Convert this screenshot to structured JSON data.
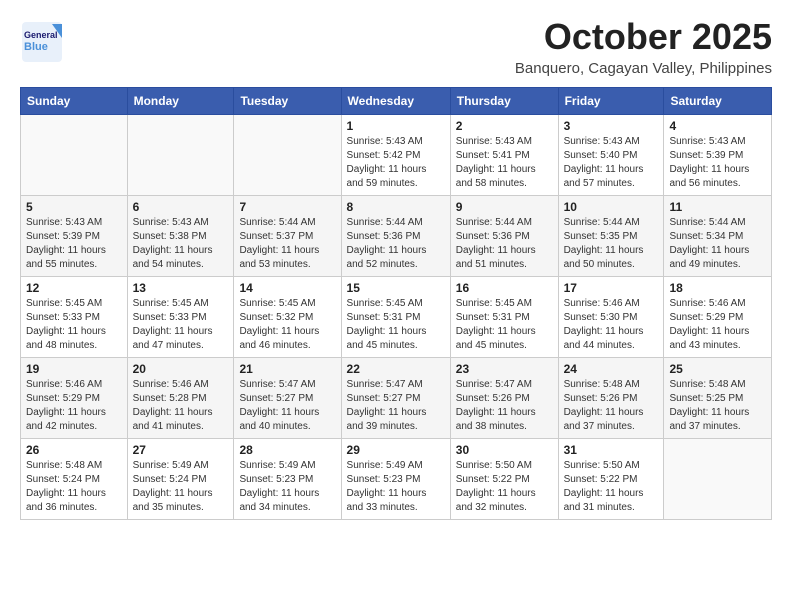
{
  "logo": {
    "line1": "General",
    "line2": "Blue"
  },
  "title": "October 2025",
  "location": "Banquero, Cagayan Valley, Philippines",
  "days_of_week": [
    "Sunday",
    "Monday",
    "Tuesday",
    "Wednesday",
    "Thursday",
    "Friday",
    "Saturday"
  ],
  "weeks": [
    [
      {
        "day": "",
        "info": ""
      },
      {
        "day": "",
        "info": ""
      },
      {
        "day": "",
        "info": ""
      },
      {
        "day": "1",
        "info": "Sunrise: 5:43 AM\nSunset: 5:42 PM\nDaylight: 11 hours\nand 59 minutes."
      },
      {
        "day": "2",
        "info": "Sunrise: 5:43 AM\nSunset: 5:41 PM\nDaylight: 11 hours\nand 58 minutes."
      },
      {
        "day": "3",
        "info": "Sunrise: 5:43 AM\nSunset: 5:40 PM\nDaylight: 11 hours\nand 57 minutes."
      },
      {
        "day": "4",
        "info": "Sunrise: 5:43 AM\nSunset: 5:39 PM\nDaylight: 11 hours\nand 56 minutes."
      }
    ],
    [
      {
        "day": "5",
        "info": "Sunrise: 5:43 AM\nSunset: 5:39 PM\nDaylight: 11 hours\nand 55 minutes."
      },
      {
        "day": "6",
        "info": "Sunrise: 5:43 AM\nSunset: 5:38 PM\nDaylight: 11 hours\nand 54 minutes."
      },
      {
        "day": "7",
        "info": "Sunrise: 5:44 AM\nSunset: 5:37 PM\nDaylight: 11 hours\nand 53 minutes."
      },
      {
        "day": "8",
        "info": "Sunrise: 5:44 AM\nSunset: 5:36 PM\nDaylight: 11 hours\nand 52 minutes."
      },
      {
        "day": "9",
        "info": "Sunrise: 5:44 AM\nSunset: 5:36 PM\nDaylight: 11 hours\nand 51 minutes."
      },
      {
        "day": "10",
        "info": "Sunrise: 5:44 AM\nSunset: 5:35 PM\nDaylight: 11 hours\nand 50 minutes."
      },
      {
        "day": "11",
        "info": "Sunrise: 5:44 AM\nSunset: 5:34 PM\nDaylight: 11 hours\nand 49 minutes."
      }
    ],
    [
      {
        "day": "12",
        "info": "Sunrise: 5:45 AM\nSunset: 5:33 PM\nDaylight: 11 hours\nand 48 minutes."
      },
      {
        "day": "13",
        "info": "Sunrise: 5:45 AM\nSunset: 5:33 PM\nDaylight: 11 hours\nand 47 minutes."
      },
      {
        "day": "14",
        "info": "Sunrise: 5:45 AM\nSunset: 5:32 PM\nDaylight: 11 hours\nand 46 minutes."
      },
      {
        "day": "15",
        "info": "Sunrise: 5:45 AM\nSunset: 5:31 PM\nDaylight: 11 hours\nand 45 minutes."
      },
      {
        "day": "16",
        "info": "Sunrise: 5:45 AM\nSunset: 5:31 PM\nDaylight: 11 hours\nand 45 minutes."
      },
      {
        "day": "17",
        "info": "Sunrise: 5:46 AM\nSunset: 5:30 PM\nDaylight: 11 hours\nand 44 minutes."
      },
      {
        "day": "18",
        "info": "Sunrise: 5:46 AM\nSunset: 5:29 PM\nDaylight: 11 hours\nand 43 minutes."
      }
    ],
    [
      {
        "day": "19",
        "info": "Sunrise: 5:46 AM\nSunset: 5:29 PM\nDaylight: 11 hours\nand 42 minutes."
      },
      {
        "day": "20",
        "info": "Sunrise: 5:46 AM\nSunset: 5:28 PM\nDaylight: 11 hours\nand 41 minutes."
      },
      {
        "day": "21",
        "info": "Sunrise: 5:47 AM\nSunset: 5:27 PM\nDaylight: 11 hours\nand 40 minutes."
      },
      {
        "day": "22",
        "info": "Sunrise: 5:47 AM\nSunset: 5:27 PM\nDaylight: 11 hours\nand 39 minutes."
      },
      {
        "day": "23",
        "info": "Sunrise: 5:47 AM\nSunset: 5:26 PM\nDaylight: 11 hours\nand 38 minutes."
      },
      {
        "day": "24",
        "info": "Sunrise: 5:48 AM\nSunset: 5:26 PM\nDaylight: 11 hours\nand 37 minutes."
      },
      {
        "day": "25",
        "info": "Sunrise: 5:48 AM\nSunset: 5:25 PM\nDaylight: 11 hours\nand 37 minutes."
      }
    ],
    [
      {
        "day": "26",
        "info": "Sunrise: 5:48 AM\nSunset: 5:24 PM\nDaylight: 11 hours\nand 36 minutes."
      },
      {
        "day": "27",
        "info": "Sunrise: 5:49 AM\nSunset: 5:24 PM\nDaylight: 11 hours\nand 35 minutes."
      },
      {
        "day": "28",
        "info": "Sunrise: 5:49 AM\nSunset: 5:23 PM\nDaylight: 11 hours\nand 34 minutes."
      },
      {
        "day": "29",
        "info": "Sunrise: 5:49 AM\nSunset: 5:23 PM\nDaylight: 11 hours\nand 33 minutes."
      },
      {
        "day": "30",
        "info": "Sunrise: 5:50 AM\nSunset: 5:22 PM\nDaylight: 11 hours\nand 32 minutes."
      },
      {
        "day": "31",
        "info": "Sunrise: 5:50 AM\nSunset: 5:22 PM\nDaylight: 11 hours\nand 31 minutes."
      },
      {
        "day": "",
        "info": ""
      }
    ]
  ]
}
